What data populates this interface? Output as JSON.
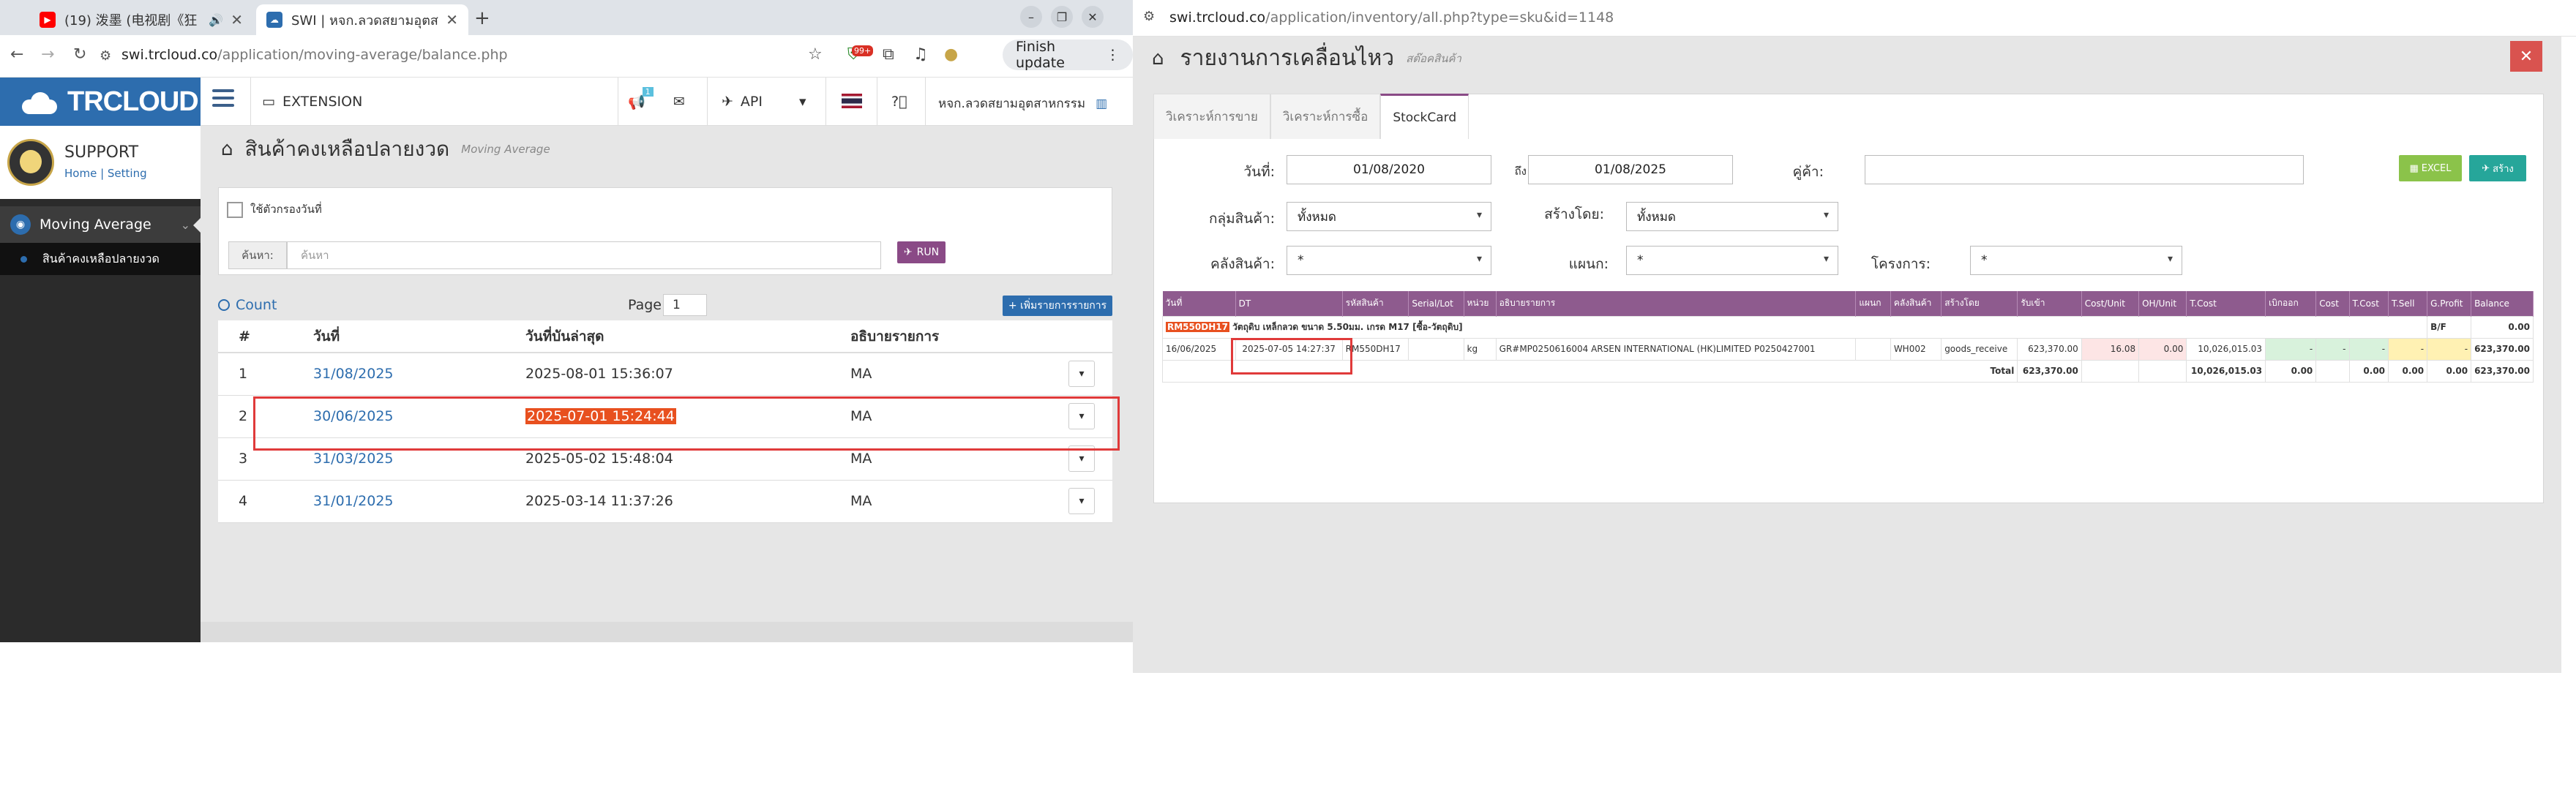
{
  "left": {
    "tabs": [
      {
        "title": "(19) 泼墨 (电视剧《狂",
        "icon": "youtube-icon",
        "audio": "🔊"
      },
      {
        "title": "SWI | หจก.ลวดสยามอุตส",
        "icon": "swi-icon"
      }
    ],
    "address": {
      "host": "swi.trcloud.co",
      "path": "/application/moving-average/balance.php"
    },
    "ext_badge": "99+",
    "finish_update": "Finish update",
    "brand": "TRCLOUD",
    "topbar": {
      "extension": "EXTENSION",
      "api": "API",
      "company": "หจก.ลวดสยามอุตสาหกรรม",
      "notify_count": "1"
    },
    "profile": {
      "name": "SUPPORT",
      "home": "Home",
      "setting": "Setting"
    },
    "menu": {
      "moving_average": "Moving Average",
      "sub": "สินค้าคงเหลือปลายงวด"
    },
    "page": {
      "title": "สินค้าคงเหลือปลายงวด",
      "subtitle": "Moving Average"
    },
    "filter": {
      "use_date_label": "ใช้ตัวกรองวันที่",
      "search_label": "ค้นหา:",
      "search_placeholder": "ค้นหา",
      "run": "RUN"
    },
    "list": {
      "count": "Count",
      "page_label": "Page:",
      "page_value": "1",
      "add_button": "+ เพิ่มรายการรายการ",
      "headers": [
        "#",
        "วันที่",
        "วันที่บันล่าสุด",
        "อธิบายรายการ"
      ],
      "rows": [
        {
          "no": "1",
          "date": "31/08/2025",
          "updated": "2025-08-01 15:36:07",
          "desc": "MA"
        },
        {
          "no": "2",
          "date": "30/06/2025",
          "updated": "2025-07-01 15:24:44",
          "desc": "MA"
        },
        {
          "no": "3",
          "date": "31/03/2025",
          "updated": "2025-05-02 15:48:04",
          "desc": "MA"
        },
        {
          "no": "4",
          "date": "31/01/2025",
          "updated": "2025-03-14 11:37:26",
          "desc": "MA"
        }
      ]
    }
  },
  "right": {
    "address": {
      "host": "swi.trcloud.co",
      "path": "/application/inventory/all.php?type=sku&id=1148"
    },
    "title": "รายงานการเคลื่อนไหว",
    "subtitle": "สต๊อคสินค้า",
    "tabs": [
      "วิเคราะห์การขาย",
      "วิเคราะห์การซื้อ",
      "StockCard"
    ],
    "filters": {
      "date_label": "วันที่:",
      "date_from": "01/08/2020",
      "to_label": "ถึง",
      "date_to": "01/08/2025",
      "partner_label": "คู่ค้า:",
      "group_label": "กลุ่มสินค้า:",
      "group_value": "ทั้งหมด",
      "created_label": "สร้างโดย:",
      "created_value": "ทั้งหมด",
      "warehouse_label": "คลังสินค้า:",
      "warehouse_value": "*",
      "dept_label": "แผนก:",
      "dept_value": "*",
      "project_label": "โครงการ:",
      "project_value": "*",
      "excel": "EXCEL",
      "print": "สร้าง"
    },
    "stock": {
      "headers": [
        "วันที่",
        "DT",
        "รหัสสินค้า",
        "Serial/Lot",
        "หน่วย",
        "อธิบายรายการ",
        "แผนก",
        "คลังสินค้า",
        "สร้างโดย",
        "รับเข้า",
        "Cost/Unit",
        "OH/Unit",
        "T.Cost",
        "เบิกออก",
        "Cost",
        "T.Cost",
        "T.Sell",
        "G.Profit",
        "Balance"
      ],
      "sku": "RM550DH17",
      "sku_desc": "วัตถุดิบ เหล็กลวด ขนาด 5.50มม. เกรด M17 [ซื้อ-วัตถุดิบ]",
      "bf_label": "B/F",
      "bf_value": "0.00",
      "row": {
        "date": "16/06/2025",
        "dt": "2025-07-05 14:27:37",
        "code": "RM550DH17",
        "serial": "",
        "unit": "kg",
        "desc": "GR#MP0250616004 ARSEN INTERNATIONAL (HK)LIMITED P0250427001",
        "dept": "",
        "wh": "WH002",
        "by": "goods_receive",
        "in": "623,370.00",
        "cost_unit": "16.08",
        "oh_unit": "0.00",
        "tcost": "10,026,015.03",
        "out": "-",
        "cost": "-",
        "tcost2": "-",
        "tsell": "-",
        "gprofit": "-",
        "balance": "623,370.00"
      },
      "total": {
        "label": "Total",
        "in": "623,370.00",
        "tcost": "10,026,015.03",
        "out": "0.00",
        "tcost2": "0.00",
        "tsell": "0.00",
        "gprofit": "0.00",
        "balance": "623,370.00"
      }
    }
  }
}
